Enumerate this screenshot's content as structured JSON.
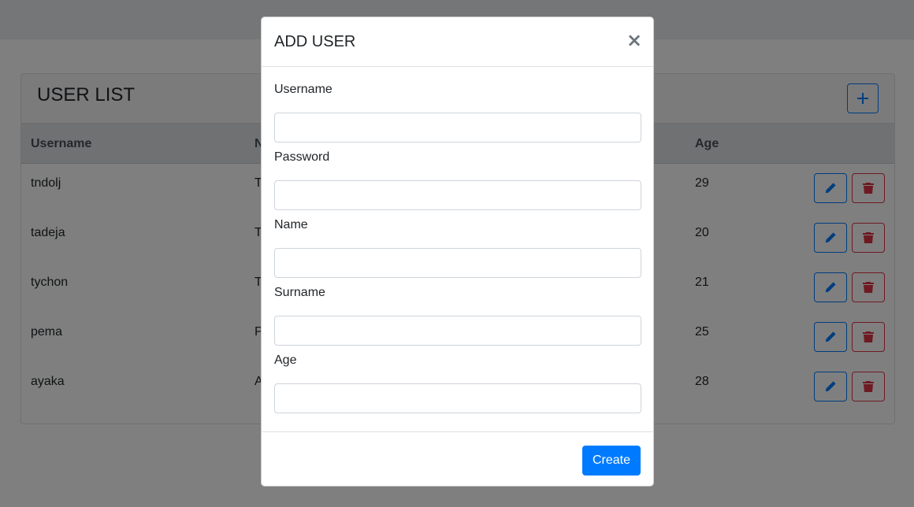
{
  "colors": {
    "primary": "#007bff",
    "danger": "#dc3545",
    "backdrop": "rgba(0,0,0,0.5)",
    "header_bg": "#dee2e6"
  },
  "card": {
    "title": "USER LIST",
    "add_icon": "plus-icon"
  },
  "table": {
    "headers": [
      "Username",
      "N",
      "Age"
    ],
    "rows": [
      {
        "username": "tndolj",
        "name": "T",
        "age": "29"
      },
      {
        "username": "tadeja",
        "name": "T",
        "age": "20"
      },
      {
        "username": "tychon",
        "name": "T",
        "age": "21"
      },
      {
        "username": "pema",
        "name": "P",
        "age": "25"
      },
      {
        "username": "ayaka",
        "name": "A",
        "age": "28"
      }
    ],
    "edit_icon": "pencil-icon",
    "delete_icon": "trash-icon"
  },
  "modal": {
    "title": "ADD USER",
    "close_label": "×",
    "fields": [
      {
        "label": "Username",
        "value": "",
        "placeholder": ""
      },
      {
        "label": "Password",
        "value": "",
        "placeholder": ""
      },
      {
        "label": "Name",
        "value": "",
        "placeholder": ""
      },
      {
        "label": "Surname",
        "value": "",
        "placeholder": ""
      },
      {
        "label": "Age",
        "value": "",
        "placeholder": ""
      }
    ],
    "submit_label": "Create"
  }
}
